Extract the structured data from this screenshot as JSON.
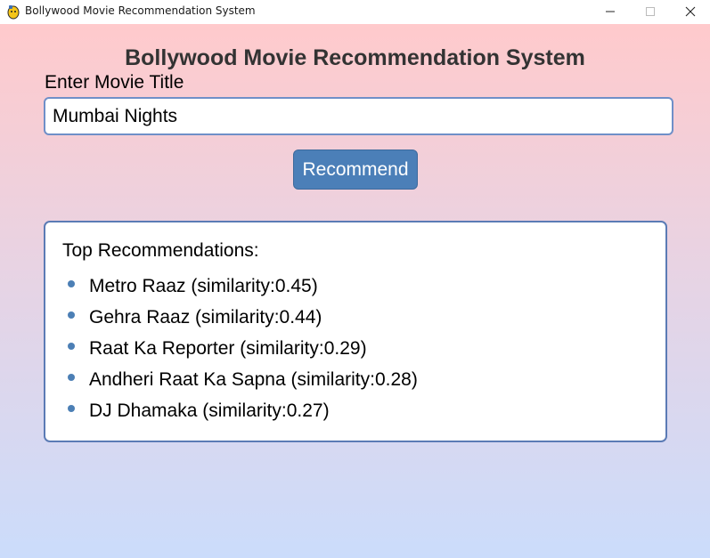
{
  "window": {
    "title": "Bollywood Movie Recommendation System",
    "icon": "python-icon",
    "controls": [
      "minimize-icon",
      "maximize-icon",
      "close-icon"
    ]
  },
  "app": {
    "title": "Bollywood Movie Recommendation System",
    "input_label": "Enter Movie Title",
    "input_value": "Mumbai Nights",
    "button_label": "Recommend",
    "results_heading": "Top Recommendations:",
    "recommendations": [
      "Metro Raaz (similarity:0.45)",
      "Gehra Raaz (similarity:0.44)",
      "Raat Ka Reporter (similarity:0.29)",
      "Andheri Raat Ka Sapna (similarity:0.28)",
      "DJ Dhamaka (similarity:0.27)"
    ]
  },
  "colors": {
    "gradient_top": "#ffcacc",
    "gradient_bottom": "#cbdcfb",
    "accent": "#4b7fb8",
    "title_text": "#333333"
  }
}
